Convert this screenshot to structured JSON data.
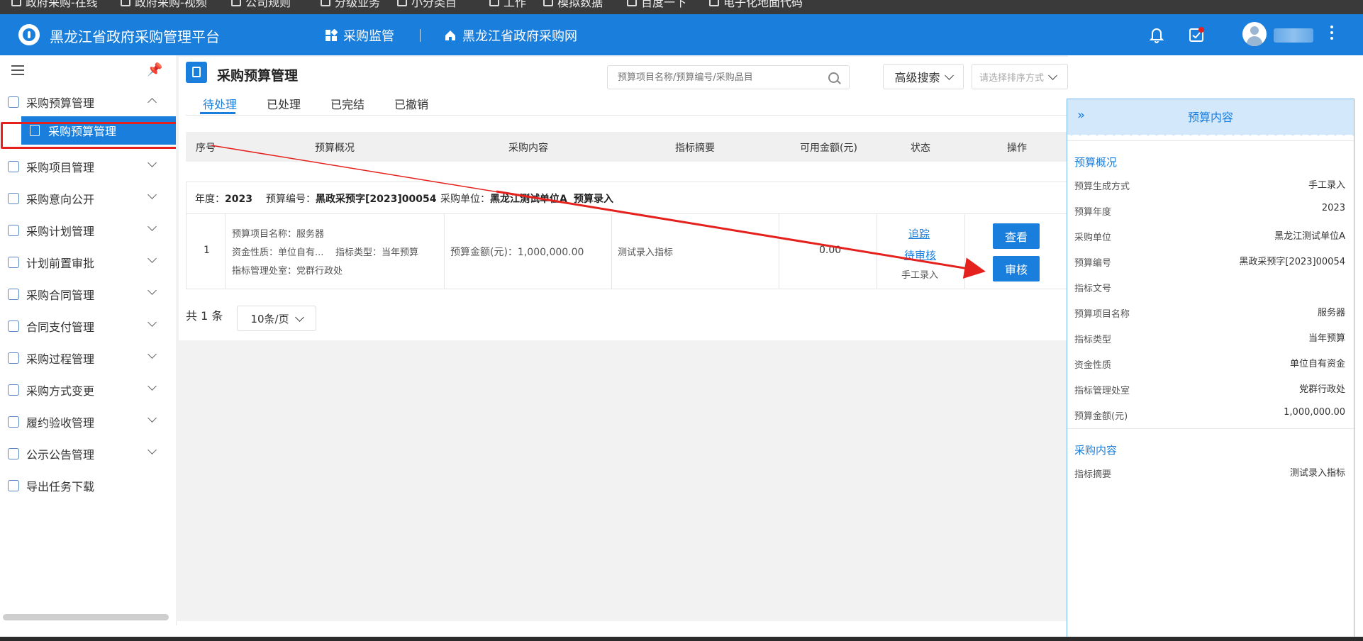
{
  "browser": {
    "bookmarks": [
      "政府采购-在线",
      "政府采购-视频",
      "公司规则",
      "分级业务",
      "小分类目",
      "工作",
      "模拟数据",
      "百度一下",
      "电子化地面代码"
    ]
  },
  "header": {
    "title": "黑龙江省政府采购管理平台",
    "nav": [
      {
        "label": "采购监管",
        "icon": "grid-icon"
      },
      {
        "label": "黑龙江省政府采购网",
        "icon": "home-icon"
      }
    ]
  },
  "sidebar": {
    "items": [
      {
        "label": "采购预算管理",
        "icon": "chart-icon",
        "expanded": true
      },
      {
        "label": "采购项目管理",
        "icon": "project-icon"
      },
      {
        "label": "采购意向公开",
        "icon": "document-icon"
      },
      {
        "label": "采购计划管理",
        "icon": "calendar-icon"
      },
      {
        "label": "计划前置审批",
        "icon": "approval-icon"
      },
      {
        "label": "采购合同管理",
        "icon": "contract-icon"
      },
      {
        "label": "合同支付管理",
        "icon": "payment-icon"
      },
      {
        "label": "采购过程管理",
        "icon": "process-icon"
      },
      {
        "label": "采购方式变更",
        "icon": "switch-icon"
      },
      {
        "label": "履约验收管理",
        "icon": "checklist-icon"
      },
      {
        "label": "公示公告管理",
        "icon": "notice-icon"
      },
      {
        "label": "导出任务下载",
        "icon": "export-icon"
      }
    ],
    "active_sub": "采购预算管理"
  },
  "page": {
    "title": "采购预算管理",
    "search_placeholder": "预算项目名称/预算编号/采购品目",
    "advanced_search": "高级搜索",
    "sort_placeholder": "请选择排序方式",
    "tabs": [
      "待处理",
      "已处理",
      "已完结",
      "已撤销"
    ],
    "active_tab": 0
  },
  "table": {
    "headers": [
      "序号",
      "预算概况",
      "采购内容",
      "指标摘要",
      "可用金额(元)",
      "状态",
      "操作"
    ],
    "record": {
      "year_label": "年度：",
      "year": "2023",
      "code_label": "预算编号：",
      "code": "黑政采预字[2023]00054",
      "unit_label": "采购单位：",
      "unit": "黑龙江测试单位A",
      "source": "预算录入",
      "index": "1",
      "overview_name": "预算项目名称：服务器",
      "overview_funds": "资金性质：单位自有...",
      "overview_type": "指标类型：当年预算",
      "overview_office": "指标管理处室：党群行政处",
      "content": "预算金额(元)：1,000,000.00",
      "summary": "测试录入指标",
      "available": "0.00",
      "status_track": "追踪",
      "status_pending": "待审核",
      "status_source": "手工录入",
      "btn_view": "查看",
      "btn_review": "审核"
    }
  },
  "pagination": {
    "total": "共 1 条",
    "page_size": "10条/页"
  },
  "right_panel": {
    "title": "预算内容",
    "section1": "预算概况",
    "fields": [
      {
        "label": "预算生成方式",
        "value": "手工录入"
      },
      {
        "label": "预算年度",
        "value": "2023"
      },
      {
        "label": "采购单位",
        "value": "黑龙江测试单位A"
      },
      {
        "label": "预算编号",
        "value": "黑政采预字[2023]00054"
      },
      {
        "label": "指标文号",
        "value": ""
      },
      {
        "label": "预算项目名称",
        "value": "服务器"
      },
      {
        "label": "指标类型",
        "value": "当年预算"
      },
      {
        "label": "资金性质",
        "value": "单位自有资金"
      },
      {
        "label": "指标管理处室",
        "value": "党群行政处"
      },
      {
        "label": "预算金额(元)",
        "value": "1,000,000.00"
      }
    ],
    "section2": "采购内容",
    "fields2": [
      {
        "label": "指标摘要",
        "value": "测试录入指标"
      }
    ]
  },
  "colors": {
    "primary": "#1a7fdc",
    "annotation": "#e5211e"
  }
}
